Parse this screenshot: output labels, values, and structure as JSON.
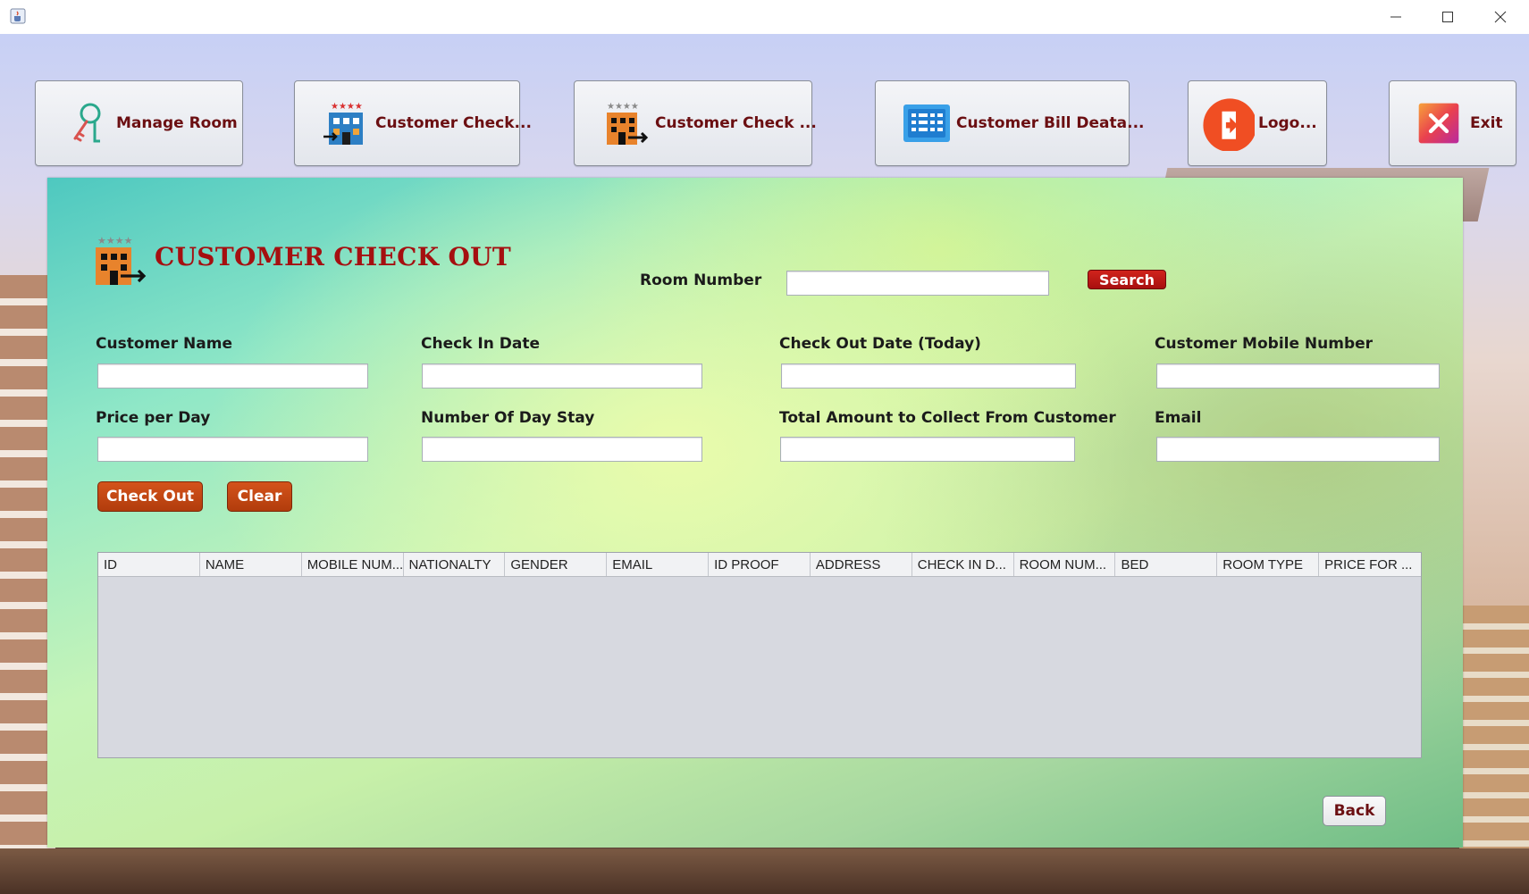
{
  "window": {
    "app_icon": "java-cup-icon",
    "controls": [
      "minimize-icon",
      "maximize-icon",
      "close-icon"
    ]
  },
  "toolbar": {
    "buttons": [
      {
        "label": "Manage Room",
        "icon": "key-icon"
      },
      {
        "label": "Customer Check...",
        "icon": "hotel-checkin-icon"
      },
      {
        "label": "Customer Check ...",
        "icon": "hotel-checkout-icon"
      },
      {
        "label": "Customer Bill Deata...",
        "icon": "bill-list-icon"
      },
      {
        "label": "Logo...",
        "icon": "logout-icon"
      },
      {
        "label": "Exit",
        "icon": "exit-x-icon"
      }
    ]
  },
  "panel": {
    "title": "CUSTOMER CHECK OUT",
    "title_icon": "hotel-checkout-icon",
    "search": {
      "label": "Room Number",
      "value": "",
      "button": "Search"
    },
    "fields": {
      "customer_name": {
        "label": "Customer Name",
        "value": ""
      },
      "check_in_date": {
        "label": "Check In Date",
        "value": ""
      },
      "check_out_date": {
        "label": "Check Out Date (Today)",
        "value": ""
      },
      "mobile_number": {
        "label": "Customer Mobile Number",
        "value": ""
      },
      "price_per_day": {
        "label": "Price per Day",
        "value": ""
      },
      "days_stay": {
        "label": "Number Of Day Stay",
        "value": ""
      },
      "total_amount": {
        "label": "Total Amount to Collect From Customer",
        "value": ""
      },
      "email": {
        "label": "Email",
        "value": ""
      }
    },
    "buttons": {
      "check_out": "Check Out",
      "clear": "Clear",
      "back": "Back"
    },
    "table": {
      "columns": [
        "ID",
        "NAME",
        "MOBILE NUM...",
        "NATIONALTY",
        "GENDER",
        "EMAIL",
        "ID PROOF",
        "ADDRESS",
        "CHECK IN D...",
        "ROOM NUM...",
        "BED",
        "ROOM TYPE",
        "PRICE FOR ..."
      ],
      "rows": []
    }
  },
  "colors": {
    "title_red": "#a50f10",
    "button_label": "#6b0f12",
    "search_red": "#c0191a",
    "orange_button": "#c4461a"
  }
}
